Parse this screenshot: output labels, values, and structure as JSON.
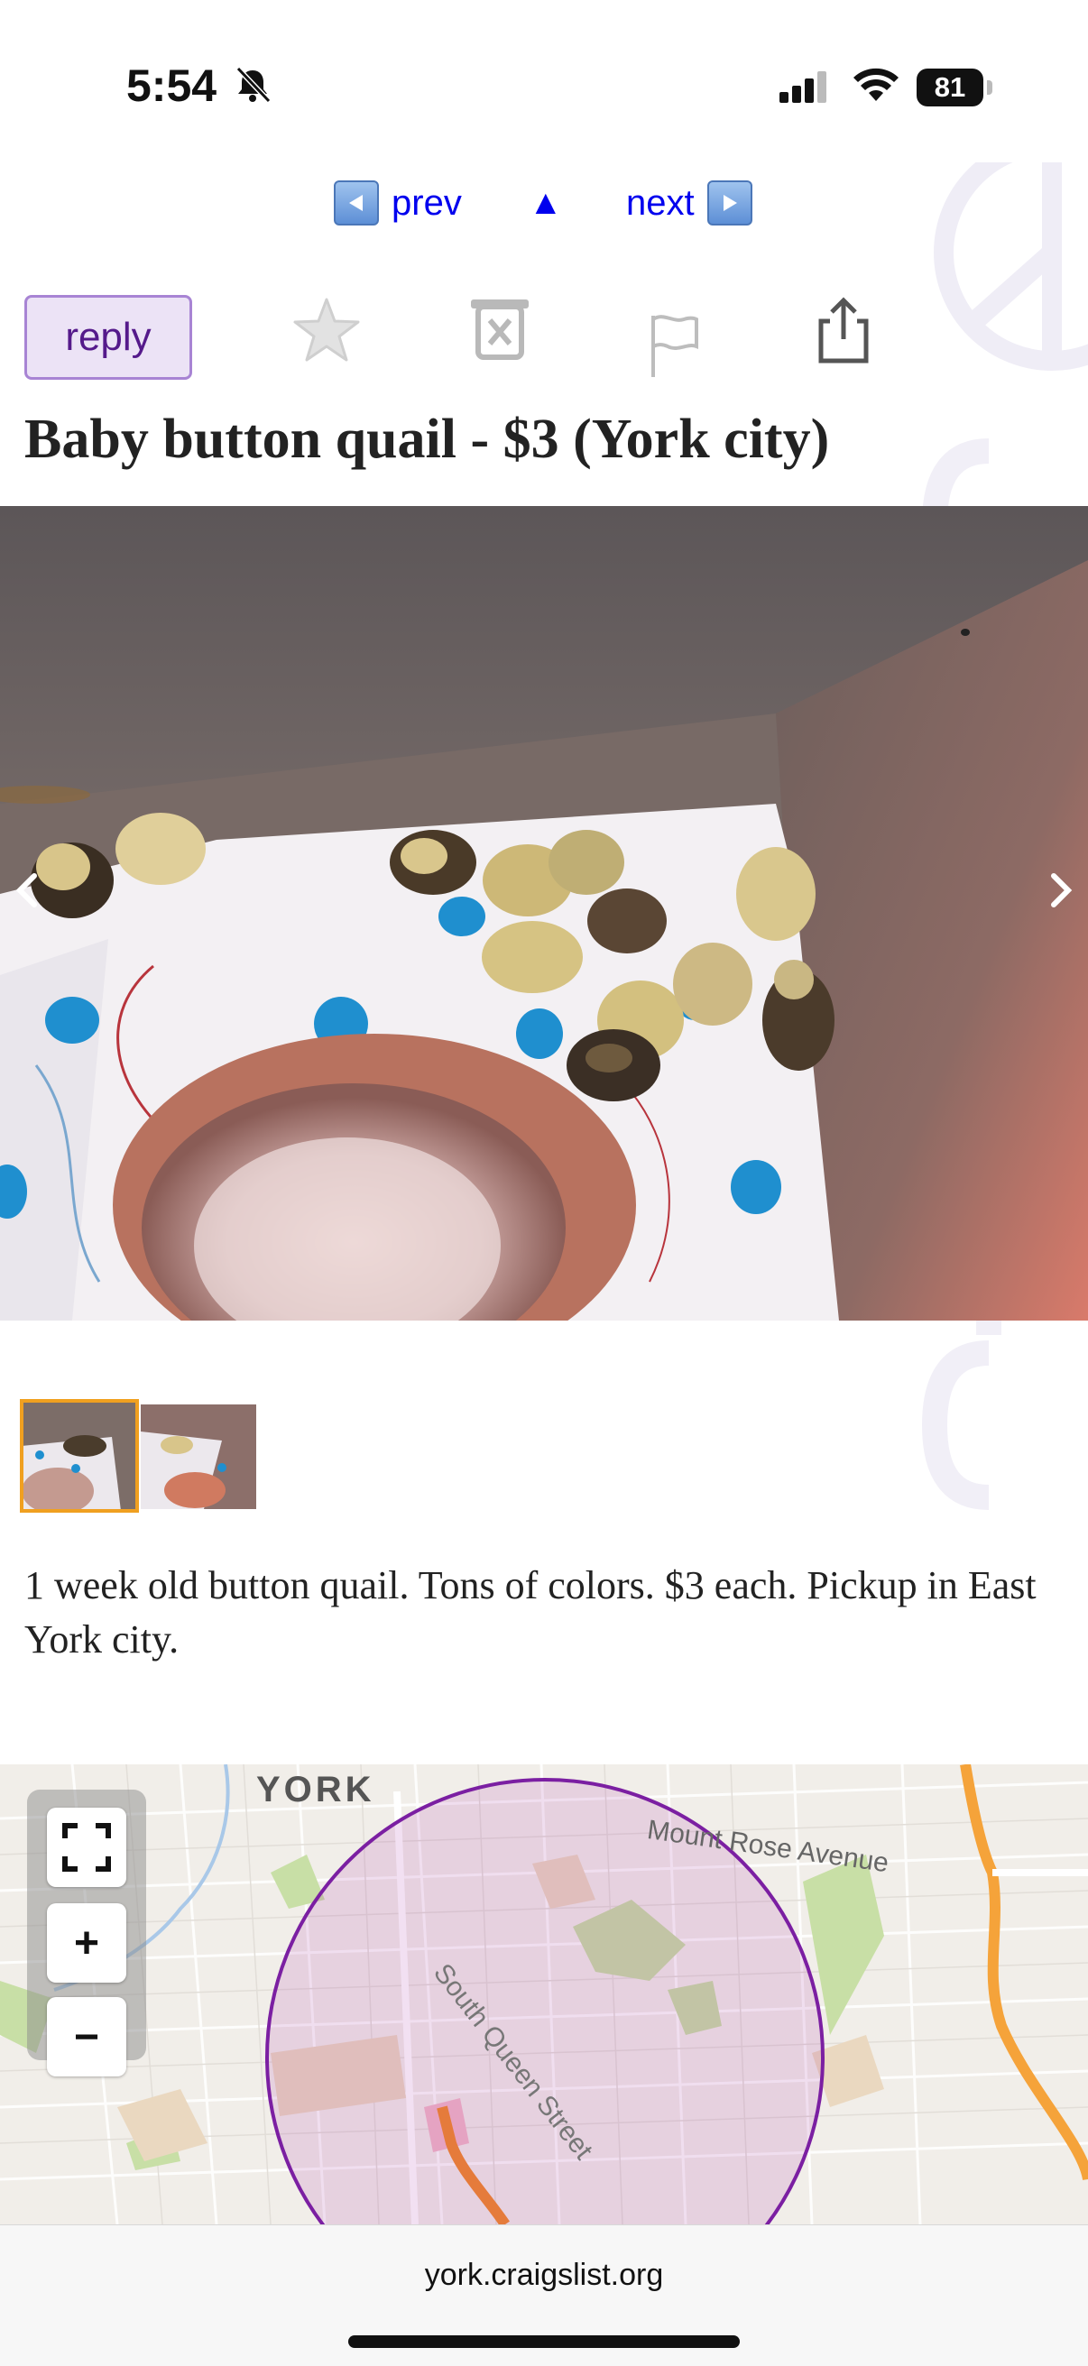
{
  "status_bar": {
    "time": "5:54",
    "battery": "81"
  },
  "nav": {
    "prev_label": "prev",
    "up_symbol": "▲",
    "next_label": "next"
  },
  "toolbar": {
    "reply_label": "reply",
    "icons": [
      "star-icon",
      "hide-icon",
      "flag-icon",
      "share-icon"
    ]
  },
  "post": {
    "title": "Baby button quail - $3 (York city)",
    "description": "1 week old button quail. Tons of colors. $3 each. Pickup in East York city.",
    "image_count": 2,
    "selected_thumbnail": 1
  },
  "map": {
    "label_city": "YORK",
    "label_avenue": "Mount Rose Avenue",
    "label_street": "South Queen Street",
    "fullscreen_symbol": "⛶",
    "zoom_in_symbol": "+",
    "zoom_out_symbol": "−",
    "circle_color": "#7b1fa2"
  },
  "url_bar": {
    "domain": "york.craigslist.org"
  },
  "colors": {
    "link": "#0000ee",
    "reply_text": "#551a8b",
    "reply_bg": "#ece3f6",
    "thumb_selected": "#f0a020"
  }
}
